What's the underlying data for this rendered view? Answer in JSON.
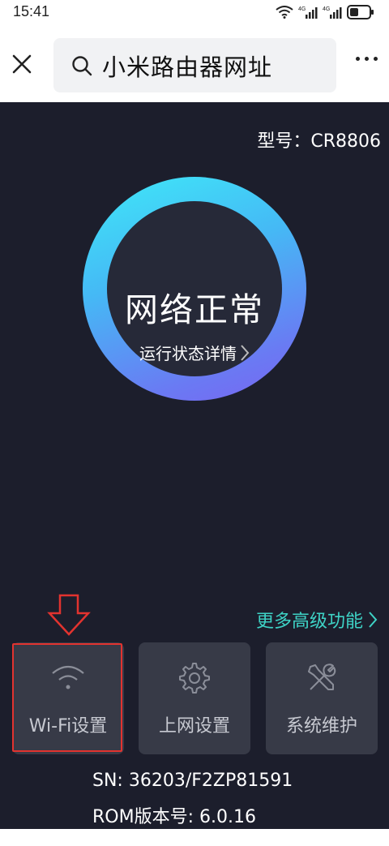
{
  "status_bar": {
    "time": "15:41",
    "signal_label_1": "4G",
    "signal_label_2": "4G"
  },
  "browser": {
    "search_text": "小米路由器网址"
  },
  "router": {
    "model": "型号：CR8806",
    "network_status": "网络正常",
    "detail_link": "运行状态详情",
    "more_functions": "更多高级功能",
    "tiles": [
      {
        "label": "Wi-Fi设置",
        "icon": "wifi-icon"
      },
      {
        "label": "上网设置",
        "icon": "gear-icon"
      },
      {
        "label": "系统维护",
        "icon": "tools-icon"
      }
    ],
    "sn": "SN:  36203/F2ZP81591",
    "rom": "ROM版本号:  6.0.16"
  },
  "colors": {
    "background": "#1c1e2c",
    "tile": "#373a47",
    "accent": "#3ed3c6",
    "highlight": "#e2332f"
  }
}
